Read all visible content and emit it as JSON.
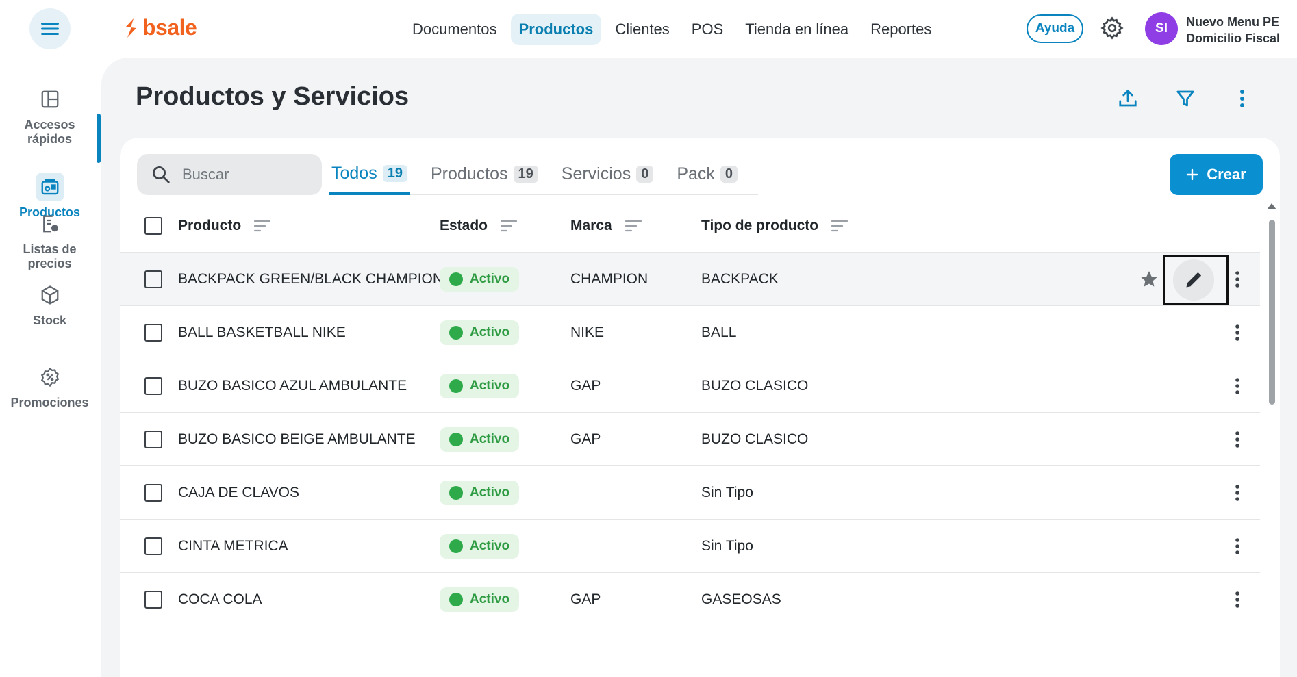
{
  "app": {
    "logo_text": "bsale",
    "brand_color": "#f2621f",
    "accent_color": "#0a84bf"
  },
  "nav": {
    "items": [
      {
        "label": "Documentos",
        "active": false
      },
      {
        "label": "Productos",
        "active": true
      },
      {
        "label": "Clientes",
        "active": false
      },
      {
        "label": "POS",
        "active": false
      },
      {
        "label": "Tienda en línea",
        "active": false
      },
      {
        "label": "Reportes",
        "active": false
      }
    ],
    "help_label": "Ayuda",
    "avatar_initials": "SI",
    "user_line1": "Nuevo Menu PE",
    "user_line2": "Domicilio Fiscal"
  },
  "sidebar": {
    "items": [
      {
        "label_line1": "Accesos",
        "label_line2": "rápidos",
        "icon": "layout-icon",
        "active": false
      },
      {
        "label_line1": "Productos",
        "label_line2": "",
        "icon": "products-icon",
        "active": true
      },
      {
        "label_line1": "Listas de",
        "label_line2": "precios",
        "icon": "price-list-icon",
        "active": false
      },
      {
        "label_line1": "Stock",
        "label_line2": "",
        "icon": "box-icon",
        "active": false
      },
      {
        "label_line1": "Promociones",
        "label_line2": "",
        "icon": "discount-icon",
        "active": false
      }
    ]
  },
  "page": {
    "title": "Productos y Servicios"
  },
  "toolbar": {
    "search_placeholder": "Buscar",
    "create_label": "Crear",
    "tabs": [
      {
        "label": "Todos",
        "count": "19",
        "active": true
      },
      {
        "label": "Productos",
        "count": "19",
        "active": false
      },
      {
        "label": "Servicios",
        "count": "0",
        "active": false
      },
      {
        "label": "Pack",
        "count": "0",
        "active": false
      }
    ]
  },
  "table": {
    "columns": [
      "Producto",
      "Estado",
      "Marca",
      "Tipo de producto"
    ],
    "rows": [
      {
        "producto": "BACKPACK GREEN/BLACK CHAMPION",
        "estado": "Activo",
        "marca": "CHAMPION",
        "tipo": "BACKPACK"
      },
      {
        "producto": "BALL BASKETBALL NIKE",
        "estado": "Activo",
        "marca": "NIKE",
        "tipo": "BALL"
      },
      {
        "producto": "BUZO BASICO AZUL AMBULANTE",
        "estado": "Activo",
        "marca": "GAP",
        "tipo": "BUZO CLASICO"
      },
      {
        "producto": "BUZO BASICO BEIGE AMBULANTE",
        "estado": "Activo",
        "marca": "GAP",
        "tipo": "BUZO CLASICO"
      },
      {
        "producto": "CAJA DE CLAVOS",
        "estado": "Activo",
        "marca": "",
        "tipo": "Sin Tipo"
      },
      {
        "producto": "CINTA METRICA",
        "estado": "Activo",
        "marca": "",
        "tipo": "Sin Tipo"
      },
      {
        "producto": "COCA COLA",
        "estado": "Activo",
        "marca": "GAP",
        "tipo": "GASEOSAS"
      }
    ]
  }
}
